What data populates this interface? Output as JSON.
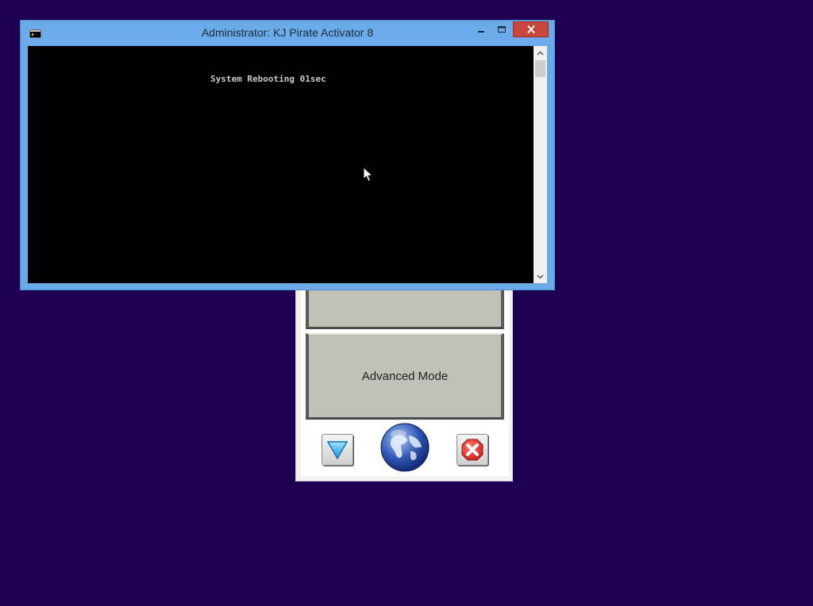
{
  "window": {
    "title": "Administrator:  KJ Pirate Activator 8",
    "icon": "console-icon",
    "controls": [
      "minimize-icon",
      "maximize-icon",
      "close-icon"
    ],
    "accent_color": "#6cabe9",
    "close_color": "#c7473d"
  },
  "console": {
    "lines": [
      "System Rebooting 01sec"
    ],
    "background_color": "#000000",
    "text_color": "#c8c8c8"
  },
  "activator_panel": {
    "advanced_label": "Advanced Mode",
    "icons": [
      "arrow-down-icon",
      "globe-icon",
      "close-icon"
    ]
  },
  "desktop": {
    "background_color": "#1e0050"
  }
}
